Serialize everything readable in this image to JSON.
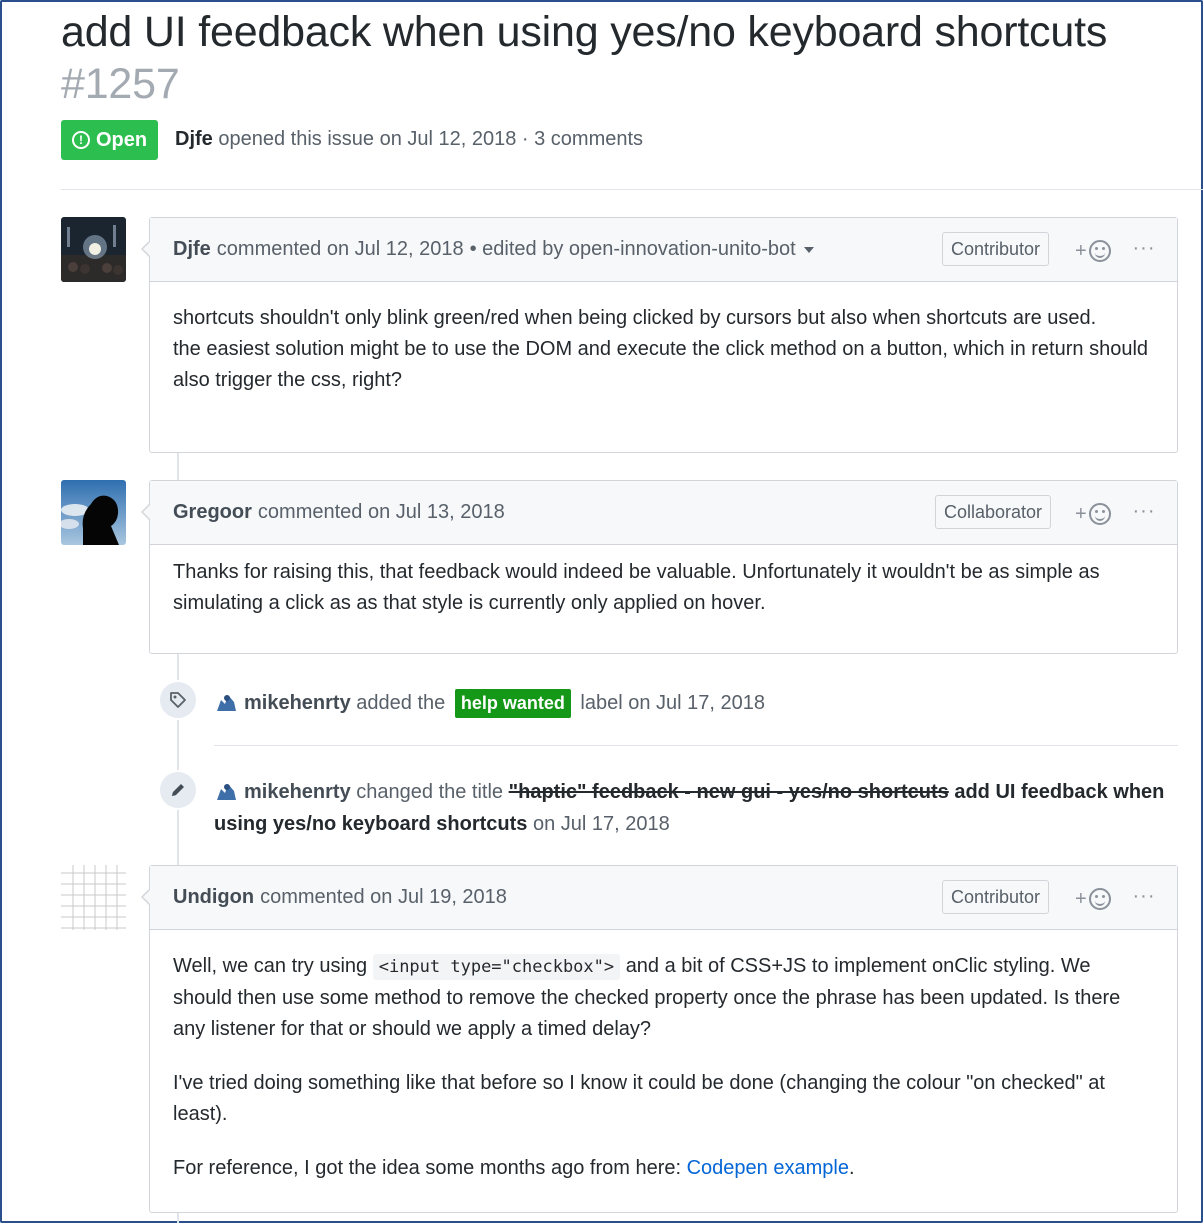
{
  "issue": {
    "title": "add UI feedback when using yes/no keyboard shortcuts",
    "number": "#1257",
    "state": "Open",
    "state_color": "#2cbe4e",
    "author": "Djfe",
    "meta_text": "opened this issue on Jul 12, 2018 · 3 comments"
  },
  "comments": [
    {
      "author": "Djfe",
      "timestamp": "commented on Jul 12, 2018",
      "edited": "• edited by open-innovation-unito-bot",
      "role": "Contributor",
      "reaction_plus": "+",
      "more": "···",
      "body": {
        "p1": "shortcuts shouldn't only blink green/red when being clicked by cursors but also when shortcuts are used.",
        "p2": "the easiest solution might be to use the DOM and execute the click method on a button, which in return should also trigger the css, right?"
      }
    },
    {
      "author": "Gregoor",
      "timestamp": "commented on Jul 13, 2018",
      "role": "Collaborator",
      "reaction_plus": "+",
      "more": "···",
      "body": {
        "p1": "Thanks for raising this, that feedback would indeed be valuable. Unfortunately it wouldn't be as simple as simulating a click as as that style is currently only applied on hover."
      }
    },
    {
      "author": "Undigon",
      "timestamp": "commented on Jul 19, 2018",
      "role": "Contributor",
      "reaction_plus": "+",
      "more": "···",
      "body": {
        "p1_before": "Well, we can try using",
        "p1_code": "<input type=\"checkbox\">",
        "p1_after": "and a bit of CSS+JS to implement onClic styling. We should then use some method to remove the checked property once the phrase has been updated. Is there any listener for that or should we apply a timed delay?",
        "p2": "I've tried doing something like that before so I know it could be done (changing the colour \"on checked\" at least).",
        "p3_before": "For reference, I got the idea some months ago from here:",
        "p3_link": "Codepen example",
        "p3_after": "."
      }
    }
  ],
  "events": {
    "label_event": {
      "actor": "mikehenrty",
      "action": "added the",
      "label": "help wanted",
      "label_color": "#159818",
      "suffix": "label on Jul 17, 2018",
      "icon": "tag-icon"
    },
    "title_event": {
      "actor": "mikehenrty",
      "action": "changed the title",
      "old_title": "\"haptic\" feedback - new gui - yes/no shortcuts",
      "new_title": "add UI feedback when using yes/no keyboard shortcuts",
      "suffix": "on Jul 17, 2018",
      "icon": "pencil-icon"
    }
  },
  "colors": {
    "link": "#0366d6",
    "frame_border": "#2b4f8c"
  }
}
